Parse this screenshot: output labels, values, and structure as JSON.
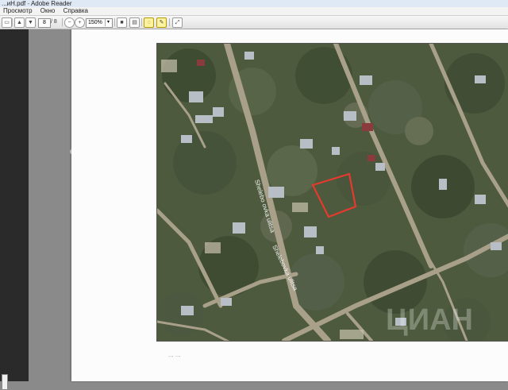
{
  "window": {
    "file": "...иН.pdf",
    "separator": " - ",
    "app": "Adobe Reader"
  },
  "menu": [
    "Просмотр",
    "Окно",
    "Справка"
  ],
  "toolbar": {
    "page_current": "8",
    "page_total": "/ 8",
    "zoom": "150%"
  },
  "map": {
    "street_label_1": "Shelebo ovka ulitsa",
    "street_label_2": "Shelebovka ulitsa",
    "watermark": "ЦИАН",
    "parcel_color": "#e53a2e"
  },
  "document": {
    "caption": "...  ..."
  }
}
